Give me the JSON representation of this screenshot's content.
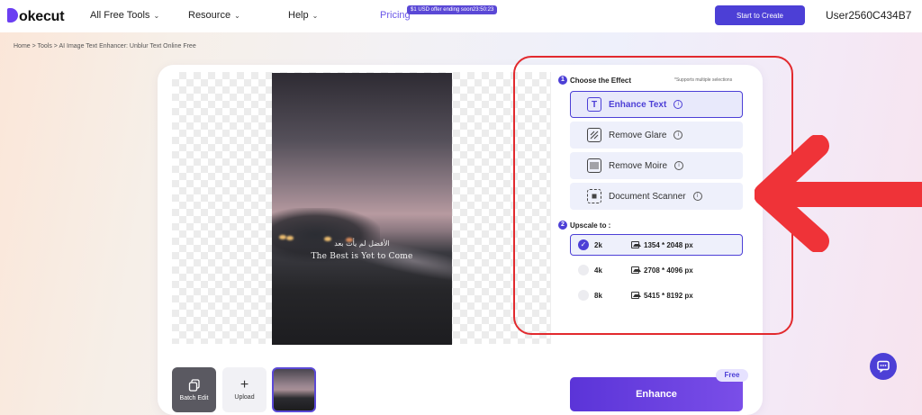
{
  "header": {
    "logo_text": "okecut",
    "nav": {
      "all_free_tools": "All Free Tools",
      "resource": "Resource",
      "help": "Help",
      "pricing": "Pricing"
    },
    "promo_badge": "$1 USD offer ending soon23:50:23",
    "start_button": "Start to Create",
    "user": "User2560C434B7"
  },
  "breadcrumb": "Home > Tools > AI Image Text Enhancer: Unblur Text Online Free",
  "preview": {
    "arabic_text": "الأفضل لم يأت بعد",
    "caption": "The Best is Yet to Come"
  },
  "thumbnails": {
    "batch_edit": "Batch Edit",
    "upload": "Upload"
  },
  "panel": {
    "step1_number": "1",
    "step1_title": "Choose the Effect",
    "supports_note": "*Supports multiple selections",
    "effects": [
      {
        "label": "Enhance Text",
        "icon": "text-T-icon",
        "active": true
      },
      {
        "label": "Remove Glare",
        "icon": "glare-icon",
        "active": false
      },
      {
        "label": "Remove Moire",
        "icon": "moire-icon",
        "active": false
      },
      {
        "label": "Document Scanner",
        "icon": "scanner-icon",
        "active": false
      }
    ],
    "step2_number": "2",
    "step2_title": "Upscale to :",
    "upscale": [
      {
        "label": "2k",
        "dims": "1354 * 2048 px",
        "selected": true
      },
      {
        "label": "4k",
        "dims": "2708 * 4096 px",
        "selected": false
      },
      {
        "label": "8k",
        "dims": "5415 * 8192 px",
        "selected": false
      }
    ],
    "enhance_button": "Enhance",
    "free_badge": "Free"
  },
  "colors": {
    "accent": "#4c3fd6",
    "annotation_red": "#e22a2e"
  }
}
